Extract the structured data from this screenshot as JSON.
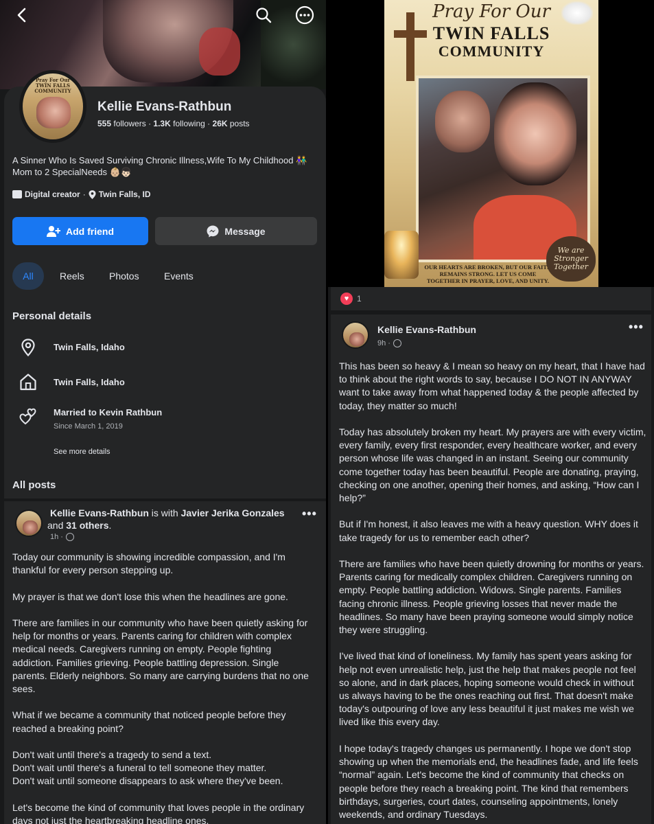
{
  "profile": {
    "name": "Kellie Evans-Rathbun",
    "stats": {
      "followers_count": "555",
      "followers_label": "followers",
      "following_count": "1.3K",
      "following_label": "following",
      "posts_count": "26K",
      "posts_label": "posts",
      "separator": "·"
    },
    "avatar_caption": "Pray For Our\nTWIN FALLS\nCOMMUNITY",
    "bio": "A Sinner Who Is Saved Surviving Chronic Illness,Wife To My Childhood 👫 Mom to 2 SpecialNeeds 👶🏼👦🏻",
    "category": "Digital creator",
    "location": "Twin Falls, ID",
    "add_friend_label": "Add friend",
    "message_label": "Message"
  },
  "top_icons": {
    "back": "back-arrow-icon",
    "search": "search-icon",
    "more": "more-icon"
  },
  "filters": [
    "All",
    "Reels",
    "Photos",
    "Events"
  ],
  "personal_details": {
    "title": "Personal details",
    "lives_in": "Twin Falls, Idaho",
    "from": "Twin Falls, Idaho",
    "relationship": "Married to Kevin Rathbun",
    "relationship_since": "Since March 1, 2019",
    "see_more": "See more details"
  },
  "all_posts_title": "All posts",
  "post_left": {
    "author": "Kellie Evans-Rathbun",
    "with_text": " is with ",
    "tagged": "Javier Jerika Gonzales",
    "and_text": " and ",
    "others": "31 others",
    "period": ".",
    "time": "1h ·",
    "more": "•••",
    "body": "Today our community is showing incredible compassion, and I'm thankful for every person stepping up.\n\nMy prayer is that we don't lose this when the headlines are gone.\n\nThere are families in our community who have been quietly asking for help for months or years. Parents caring for children with complex medical needs. Caregivers running on empty. People fighting addiction. Families grieving. People battling depression. Single parents. Elderly neighbors. So many are carrying burdens that no one sees.\n\nWhat if we became a community that noticed people before they reached a breaking point?\n\nDon't wait until there's a tragedy to send a text.\nDon't wait until there's a funeral to tell someone they matter.\nDon't wait until someone disappears to ask where they've been.\n\nLet's become the kind of community that loves people in the ordinary days not just the heartbreaking headline ones."
  },
  "poster": {
    "title_line1": "Pray For Our",
    "title_line2": "TWIN FALLS",
    "title_line3": "COMMUNITY",
    "caption": "OUR HEARTS ARE BROKEN, BUT OUR FAITH REMAINS STRONG. LET US COME TOGETHER IN PRAYER, LOVE, AND UNITY.",
    "heart_text": "We are Stronger Together"
  },
  "reactions": {
    "count": "1",
    "icon": "heart-reaction-icon"
  },
  "post_right": {
    "author": "Kellie Evans-Rathbun",
    "time": "9h ·",
    "more": "•••",
    "body": "This has been so heavy & I mean so heavy on my heart, that I have had to think about the right words to say, because I DO NOT IN ANYWAY want to take away from what happened today & the people affected by today, they matter so much!\n\nToday has absolutely broken my heart. My prayers are with every victim, every family, every first responder, every healthcare worker, and every person whose life was changed in an instant. Seeing our community come together today has been beautiful. People are donating, praying, checking on one another, opening their homes, and asking, “How can I help?”\n\nBut if I'm honest, it also leaves me with a heavy question. WHY does it take tragedy for us to remember each other?\n\nThere are families who have been quietly drowning for months or years. Parents caring for medically complex children. Caregivers running on empty. People battling addiction. Widows. Single parents. Families facing chronic illness. People grieving losses that never made the headlines. So many have been praying someone would simply notice they were struggling.\n\nI've lived that kind of loneliness. My family has spent years asking for help not even unrealistic help, just the help that makes people not feel so alone, and in dark places, hoping someone would check in without us always having to be the ones reaching out first. That doesn't make today's outpouring of love any less beautiful it just makes me wish we lived like this every day.\n\nI hope today's tragedy changes us permanently. I hope we don't stop showing up when the memorials end, the headlines fade, and life feels “normal” again. Let's become the kind of community that checks on people before they reach a breaking point. The kind that remembers birthdays, surgeries, court dates, counseling appointments, lonely weekends, and ordinary Tuesdays."
  },
  "colors": {
    "primary": "#1877f2",
    "card": "#242526",
    "page": "#18191a",
    "secondary_button": "#3a3b3c",
    "heart": "#f33e58"
  }
}
